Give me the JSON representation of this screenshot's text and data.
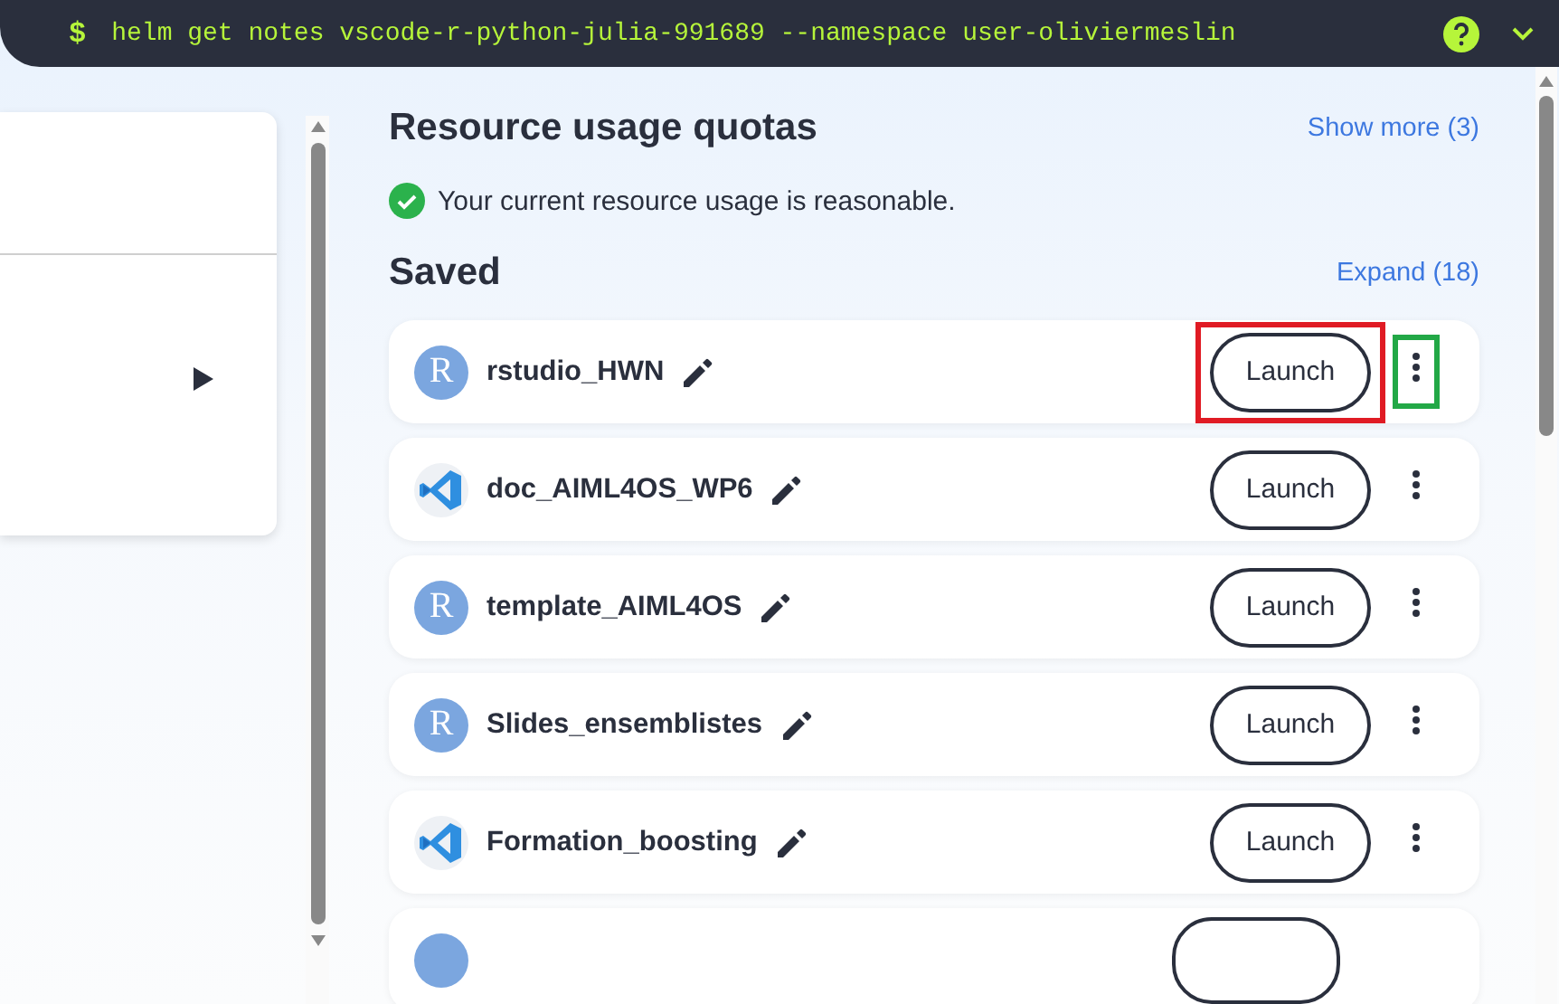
{
  "command_bar": {
    "prompt": "$",
    "command": "helm get notes vscode-r-python-julia-991689 --namespace user-oliviermeslin"
  },
  "quotas": {
    "title": "Resource usage quotas",
    "link": "Show more (3)",
    "status": "Your current resource usage is reasonable.",
    "ok": true
  },
  "saved": {
    "title": "Saved",
    "link": "Expand (18)",
    "items": [
      {
        "kind": "rstudio",
        "badge": "R",
        "name": "rstudio_HWN",
        "action": "Launch",
        "launch_outlined": true,
        "menu_outlined": true
      },
      {
        "kind": "vscode",
        "name": "doc_AIML4OS_WP6",
        "action": "Launch",
        "launch_outlined": false,
        "menu_outlined": false
      },
      {
        "kind": "rstudio",
        "badge": "R",
        "name": "template_AIML4OS",
        "action": "Launch",
        "launch_outlined": false,
        "menu_outlined": false
      },
      {
        "kind": "rstudio",
        "badge": "R",
        "name": "Slides_ensemblistes",
        "action": "Launch",
        "launch_outlined": false,
        "menu_outlined": false
      },
      {
        "kind": "vscode",
        "name": "Formation_boosting",
        "action": "Launch",
        "launch_outlined": false,
        "menu_outlined": false
      },
      {
        "kind": "rstudio",
        "cut": true
      }
    ]
  }
}
